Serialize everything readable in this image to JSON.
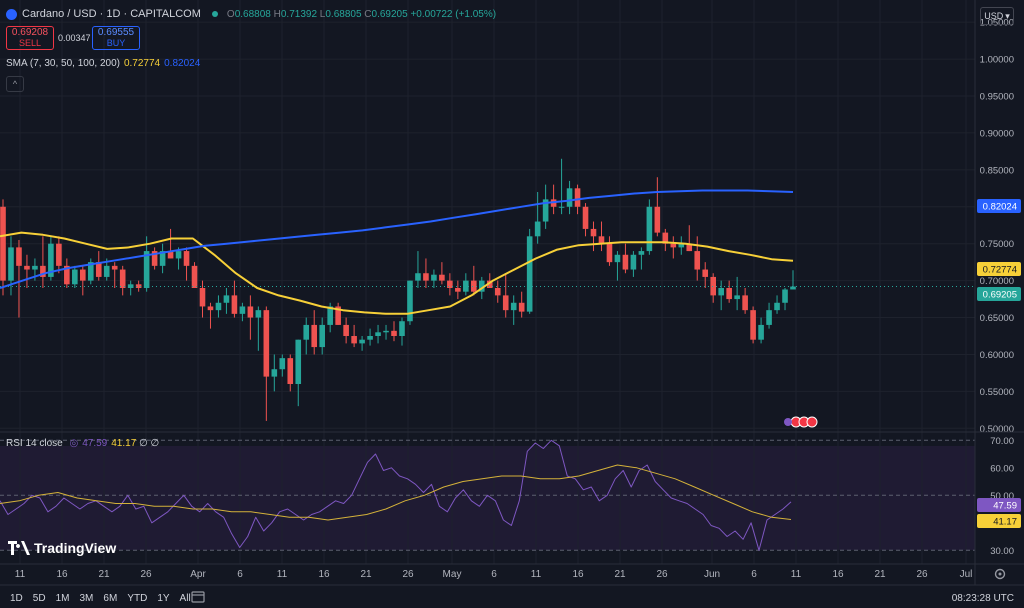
{
  "header": {
    "symbol": "Cardano / USD · 1D · CAPITALCOM",
    "open_label": "O",
    "open": "0.68808",
    "high_label": "H",
    "high": "0.71392",
    "low_label": "L",
    "low": "0.68805",
    "close_label": "C",
    "close": "0.69205",
    "change": "+0.00722 (+1.05%)"
  },
  "trade": {
    "sell_price": "0.69208",
    "sell_label": "SELL",
    "spread": "0.00347",
    "buy_price": "0.69555",
    "buy_label": "BUY"
  },
  "sma": {
    "label": "SMA (7, 30, 50, 100, 200)",
    "v1": "0.72774",
    "v2": "0.82024"
  },
  "rsi": {
    "label": "RSI 14 close",
    "v1": "47.59",
    "v2": "41.17",
    "extra": "∅ ∅"
  },
  "currency": "USD",
  "logo": "TradingView",
  "timeframes": [
    "1D",
    "5D",
    "1M",
    "3M",
    "6M",
    "YTD",
    "1Y",
    "All"
  ],
  "clock": "08:23:28 UTC",
  "colors": {
    "up": "#26a69a",
    "down": "#ef5350",
    "sma_short": "#f7d038",
    "sma_long": "#2962ff",
    "rsi": "#7e57c2",
    "rsi_ma": "#d4b23a"
  },
  "chart_data": [
    {
      "type": "candlestick",
      "title": "Cardano / USD · 1D · CAPITALCOM",
      "ylim": [
        0.495,
        1.08
      ],
      "y_ticks": [
        "1.05000",
        "1.00000",
        "0.95000",
        "0.90000",
        "0.85000",
        "0.80000",
        "0.75000",
        "0.70000",
        "0.65000",
        "0.60000",
        "0.55000",
        "0.50000"
      ],
      "x_tick_labels": [
        "11",
        "16",
        "21",
        "26",
        "Apr",
        "6",
        "11",
        "16",
        "21",
        "26",
        "May",
        "6",
        "11",
        "16",
        "21",
        "26",
        "Jun",
        "6",
        "11",
        "16",
        "21",
        "26",
        "Jul"
      ],
      "price_badges": [
        {
          "value": "0.82024",
          "color": "#2962ff"
        },
        {
          "value": "0.72774",
          "color": "#f7d038"
        },
        {
          "value": "0.69205",
          "color": "#26a69a"
        }
      ],
      "ohlc": [
        [
          0.8,
          0.81,
          0.68,
          0.7
        ],
        [
          0.7,
          0.76,
          0.68,
          0.745
        ],
        [
          0.745,
          0.755,
          0.65,
          0.72
        ],
        [
          0.72,
          0.735,
          0.69,
          0.715
        ],
        [
          0.715,
          0.73,
          0.7,
          0.72
        ],
        [
          0.72,
          0.76,
          0.69,
          0.705
        ],
        [
          0.705,
          0.76,
          0.7,
          0.75
        ],
        [
          0.75,
          0.76,
          0.71,
          0.72
        ],
        [
          0.72,
          0.73,
          0.69,
          0.695
        ],
        [
          0.695,
          0.72,
          0.69,
          0.715
        ],
        [
          0.715,
          0.72,
          0.68,
          0.7
        ],
        [
          0.7,
          0.73,
          0.695,
          0.725
        ],
        [
          0.725,
          0.74,
          0.7,
          0.705
        ],
        [
          0.705,
          0.73,
          0.7,
          0.72
        ],
        [
          0.72,
          0.725,
          0.69,
          0.715
        ],
        [
          0.715,
          0.72,
          0.68,
          0.69
        ],
        [
          0.69,
          0.7,
          0.68,
          0.695
        ],
        [
          0.695,
          0.7,
          0.685,
          0.69
        ],
        [
          0.69,
          0.76,
          0.685,
          0.74
        ],
        [
          0.74,
          0.745,
          0.715,
          0.72
        ],
        [
          0.72,
          0.75,
          0.71,
          0.74
        ],
        [
          0.74,
          0.77,
          0.73,
          0.73
        ],
        [
          0.73,
          0.745,
          0.715,
          0.74
        ],
        [
          0.74,
          0.745,
          0.7,
          0.72
        ],
        [
          0.72,
          0.725,
          0.69,
          0.69
        ],
        [
          0.69,
          0.7,
          0.65,
          0.665
        ],
        [
          0.665,
          0.67,
          0.635,
          0.66
        ],
        [
          0.66,
          0.68,
          0.65,
          0.67
        ],
        [
          0.67,
          0.69,
          0.655,
          0.68
        ],
        [
          0.68,
          0.7,
          0.65,
          0.655
        ],
        [
          0.655,
          0.67,
          0.645,
          0.665
        ],
        [
          0.665,
          0.68,
          0.62,
          0.65
        ],
        [
          0.65,
          0.665,
          0.605,
          0.66
        ],
        [
          0.66,
          0.665,
          0.51,
          0.57
        ],
        [
          0.57,
          0.6,
          0.55,
          0.58
        ],
        [
          0.58,
          0.6,
          0.57,
          0.595
        ],
        [
          0.595,
          0.6,
          0.55,
          0.56
        ],
        [
          0.56,
          0.62,
          0.53,
          0.62
        ],
        [
          0.62,
          0.65,
          0.6,
          0.64
        ],
        [
          0.64,
          0.66,
          0.6,
          0.61
        ],
        [
          0.61,
          0.65,
          0.6,
          0.64
        ],
        [
          0.64,
          0.67,
          0.63,
          0.665
        ],
        [
          0.665,
          0.67,
          0.64,
          0.64
        ],
        [
          0.64,
          0.65,
          0.615,
          0.625
        ],
        [
          0.625,
          0.64,
          0.61,
          0.615
        ],
        [
          0.615,
          0.625,
          0.605,
          0.62
        ],
        [
          0.62,
          0.635,
          0.612,
          0.625
        ],
        [
          0.625,
          0.64,
          0.615,
          0.63
        ],
        [
          0.63,
          0.64,
          0.62,
          0.632
        ],
        [
          0.632,
          0.645,
          0.618,
          0.625
        ],
        [
          0.625,
          0.65,
          0.612,
          0.645
        ],
        [
          0.645,
          0.7,
          0.64,
          0.7
        ],
        [
          0.7,
          0.74,
          0.69,
          0.71
        ],
        [
          0.71,
          0.73,
          0.69,
          0.7
        ],
        [
          0.7,
          0.715,
          0.69,
          0.708
        ],
        [
          0.708,
          0.725,
          0.695,
          0.7
        ],
        [
          0.7,
          0.71,
          0.68,
          0.69
        ],
        [
          0.69,
          0.7,
          0.675,
          0.685
        ],
        [
          0.685,
          0.71,
          0.68,
          0.7
        ],
        [
          0.7,
          0.72,
          0.68,
          0.685
        ],
        [
          0.685,
          0.705,
          0.675,
          0.7
        ],
        [
          0.7,
          0.71,
          0.69,
          0.69
        ],
        [
          0.69,
          0.7,
          0.67,
          0.68
        ],
        [
          0.68,
          0.71,
          0.65,
          0.66
        ],
        [
          0.66,
          0.68,
          0.64,
          0.67
        ],
        [
          0.67,
          0.685,
          0.65,
          0.658
        ],
        [
          0.658,
          0.77,
          0.655,
          0.76
        ],
        [
          0.76,
          0.82,
          0.75,
          0.78
        ],
        [
          0.78,
          0.83,
          0.77,
          0.81
        ],
        [
          0.81,
          0.83,
          0.79,
          0.8
        ],
        [
          0.8,
          0.865,
          0.79,
          0.8
        ],
        [
          0.8,
          0.835,
          0.79,
          0.825
        ],
        [
          0.825,
          0.83,
          0.79,
          0.8
        ],
        [
          0.8,
          0.805,
          0.76,
          0.77
        ],
        [
          0.77,
          0.78,
          0.74,
          0.76
        ],
        [
          0.76,
          0.78,
          0.74,
          0.75
        ],
        [
          0.75,
          0.76,
          0.72,
          0.725
        ],
        [
          0.725,
          0.74,
          0.7,
          0.735
        ],
        [
          0.735,
          0.75,
          0.71,
          0.715
        ],
        [
          0.715,
          0.74,
          0.705,
          0.735
        ],
        [
          0.735,
          0.745,
          0.715,
          0.74
        ],
        [
          0.74,
          0.81,
          0.735,
          0.8
        ],
        [
          0.8,
          0.84,
          0.76,
          0.765
        ],
        [
          0.765,
          0.77,
          0.74,
          0.75
        ],
        [
          0.75,
          0.76,
          0.73,
          0.745
        ],
        [
          0.745,
          0.76,
          0.735,
          0.75
        ],
        [
          0.75,
          0.775,
          0.74,
          0.74
        ],
        [
          0.74,
          0.76,
          0.7,
          0.715
        ],
        [
          0.715,
          0.725,
          0.69,
          0.705
        ],
        [
          0.705,
          0.71,
          0.67,
          0.68
        ],
        [
          0.68,
          0.7,
          0.66,
          0.69
        ],
        [
          0.69,
          0.7,
          0.67,
          0.675
        ],
        [
          0.675,
          0.705,
          0.66,
          0.68
        ],
        [
          0.68,
          0.69,
          0.655,
          0.66
        ],
        [
          0.66,
          0.665,
          0.615,
          0.62
        ],
        [
          0.62,
          0.65,
          0.615,
          0.64
        ],
        [
          0.64,
          0.67,
          0.635,
          0.66
        ],
        [
          0.66,
          0.68,
          0.655,
          0.67
        ],
        [
          0.67,
          0.69,
          0.66,
          0.688
        ],
        [
          0.688,
          0.714,
          0.688,
          0.692
        ]
      ],
      "sma_short": [
        0.76,
        0.765,
        0.762,
        0.757,
        0.75,
        0.743,
        0.745,
        0.75,
        0.757,
        0.757,
        0.735,
        0.71,
        0.69,
        0.68,
        0.673,
        0.665,
        0.66,
        0.657,
        0.655,
        0.655,
        0.66,
        0.665,
        0.68,
        0.7,
        0.715,
        0.73,
        0.742,
        0.748,
        0.75,
        0.752,
        0.752,
        0.752,
        0.75,
        0.746,
        0.74,
        0.735,
        0.729,
        0.727
      ],
      "sma_long": [
        0.69,
        0.7,
        0.71,
        0.717,
        0.722,
        0.727,
        0.732,
        0.737,
        0.742,
        0.747,
        0.75,
        0.753,
        0.756,
        0.759,
        0.762,
        0.765,
        0.768,
        0.772,
        0.776,
        0.78,
        0.785,
        0.79,
        0.795,
        0.8,
        0.805,
        0.808,
        0.812,
        0.815,
        0.818,
        0.82,
        0.821,
        0.822,
        0.822,
        0.822,
        0.821,
        0.82
      ],
      "grid": true
    },
    {
      "type": "line",
      "title": "RSI 14 close",
      "ylim": [
        25,
        73
      ],
      "y_ticks": [
        "70.00",
        "60.00",
        "50.00",
        "40.00",
        "30.00"
      ],
      "value_badges": [
        {
          "value": "47.59",
          "color": "#7e57c2"
        },
        {
          "value": "41.17",
          "color": "#f7d038"
        }
      ],
      "series": [
        {
          "values": [
            48,
            43,
            45,
            47,
            50,
            49,
            44,
            46,
            49,
            47,
            45,
            47,
            48,
            46,
            44,
            46,
            50,
            45,
            46,
            40,
            42,
            44,
            47,
            50,
            46,
            44,
            47,
            44,
            42,
            36,
            31,
            35,
            42,
            37,
            40,
            44,
            45,
            43,
            41,
            43,
            44,
            46,
            48,
            47,
            50,
            56,
            62,
            65,
            59,
            60,
            57,
            56,
            54,
            51,
            54,
            46,
            44,
            49,
            52,
            48,
            46,
            50,
            48,
            41,
            39,
            48,
            66,
            69,
            67,
            70,
            68,
            57,
            56,
            52,
            53,
            48,
            50,
            56,
            59,
            53,
            59,
            61,
            55,
            52,
            49,
            48,
            47,
            45,
            43,
            39,
            38,
            35,
            37,
            34,
            40,
            30,
            41,
            43,
            45,
            47.59
          ]
        },
        {
          "values": [
            47,
            48,
            50,
            51,
            49,
            48,
            47,
            47,
            46,
            46,
            45,
            45,
            44,
            44,
            43,
            42,
            42,
            41,
            42,
            43,
            45,
            48,
            50,
            53,
            55,
            56,
            57,
            57,
            56,
            56,
            57,
            59,
            61,
            60,
            58,
            56,
            53,
            50,
            47,
            44,
            42,
            41.17
          ]
        }
      ]
    }
  ]
}
